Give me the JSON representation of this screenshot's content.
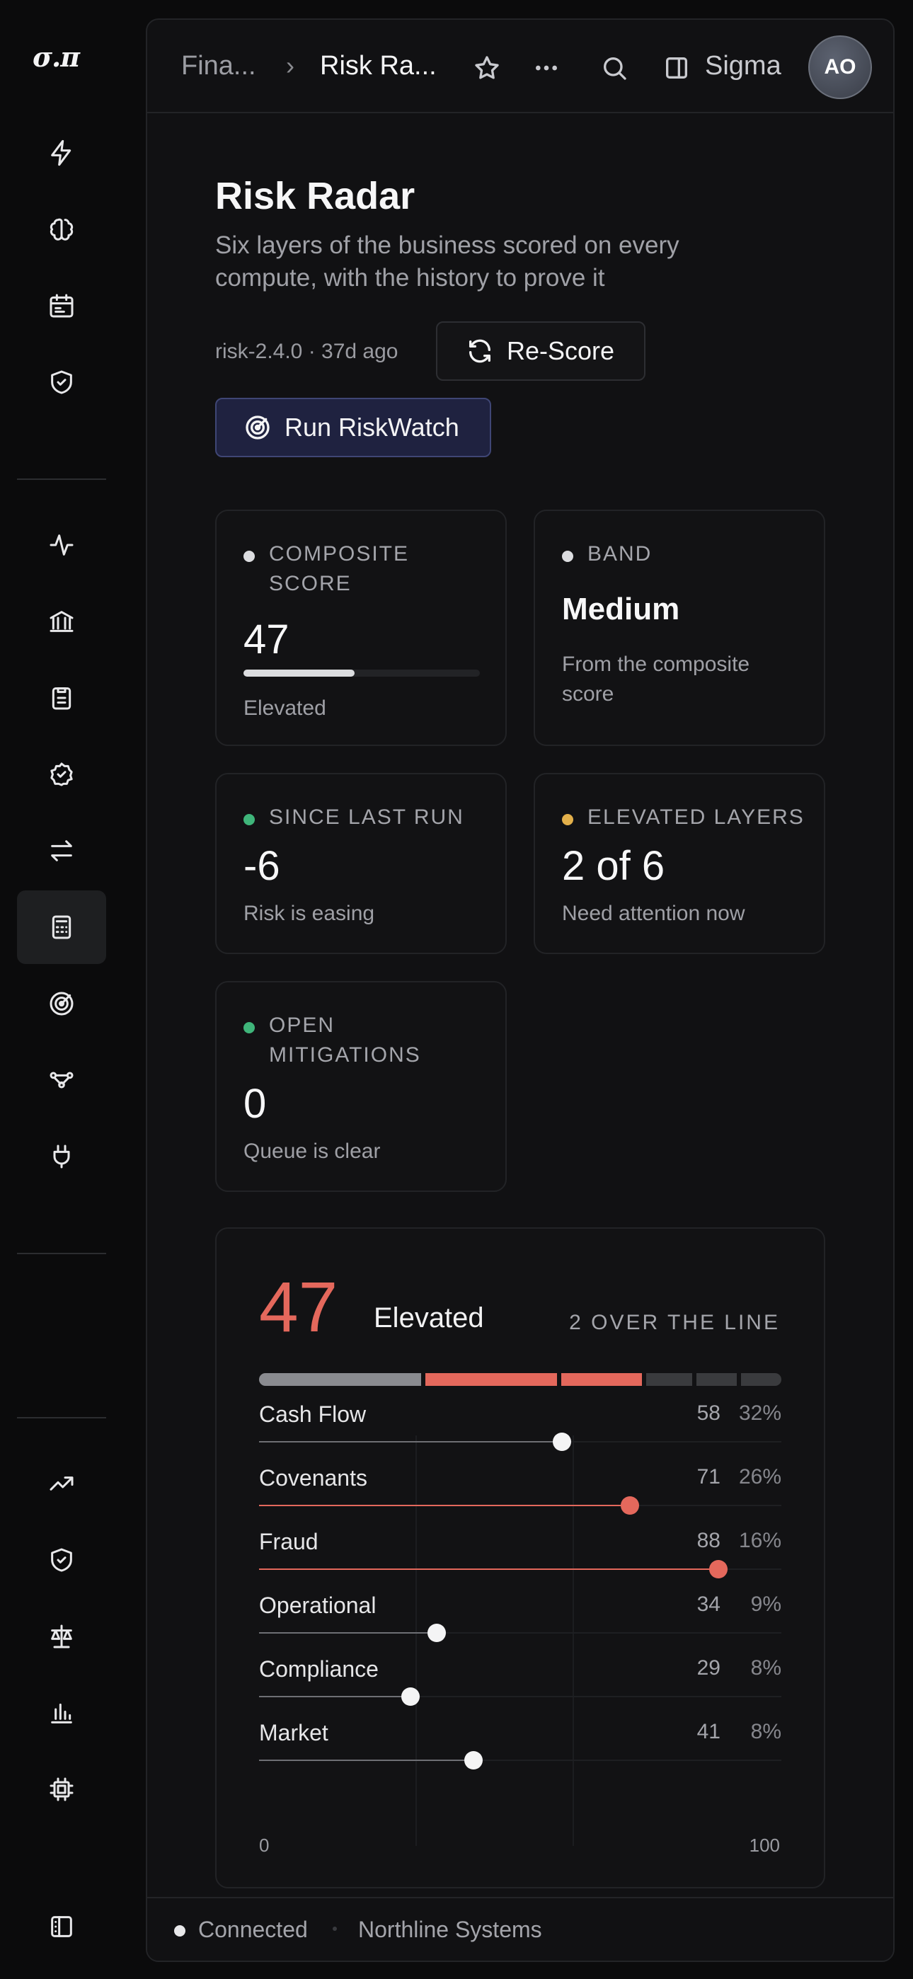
{
  "app": {
    "logo": "σ.π",
    "workspace": "Sigma",
    "avatar_initials": "AO"
  },
  "breadcrumb": {
    "parent": "Fina...",
    "current": "Risk Ra..."
  },
  "page": {
    "title": "Risk Radar",
    "subtitle": "Six layers of the business scored on every compute, with the history to prove it",
    "version": "risk-2.4.0 · 37d ago",
    "rescore_label": "Re-Score",
    "run_label": "Run RiskWatch"
  },
  "stats": {
    "composite": {
      "label": "Composite Score",
      "value": "47",
      "sub": "Elevated",
      "progress": 0.47,
      "dot_color": "#dcdde0"
    },
    "band": {
      "label": "Band",
      "value": "Medium",
      "sub": "From the composite score",
      "dot_color": "#dcdde0"
    },
    "since": {
      "label": "Since Last Run",
      "value": "-6",
      "sub": "Risk is easing",
      "dot_color": "#3fb57a"
    },
    "elevated": {
      "label": "Elevated Layers",
      "value": "2 of 6",
      "sub": "Need attention now",
      "dot_color": "#e3b04b"
    },
    "mitigations": {
      "label": "Open Mitigations",
      "value": "0",
      "sub": "Queue is clear",
      "dot_color": "#3fb57a"
    }
  },
  "radar": {
    "score": "47",
    "band": "Elevated",
    "over_line": "2 OVER THE LINE",
    "axis_min": "0",
    "axis_max": "100",
    "threshold": 60,
    "layers": [
      {
        "name": "Cash Flow",
        "score": 58,
        "weight": "32%",
        "weight_value": 32
      },
      {
        "name": "Covenants",
        "score": 71,
        "weight": "26%",
        "weight_value": 26
      },
      {
        "name": "Fraud",
        "score": 88,
        "weight": "16%",
        "weight_value": 16
      },
      {
        "name": "Operational",
        "score": 34,
        "weight": "9%",
        "weight_value": 9
      },
      {
        "name": "Compliance",
        "score": 29,
        "weight": "8%",
        "weight_value": 8
      },
      {
        "name": "Market",
        "score": 41,
        "weight": "8%",
        "weight_value": 8
      }
    ],
    "colors": {
      "over": "#e4685c",
      "normal": "#6e6f74",
      "muted": "#3a3b3e",
      "knob": "#f4f4f5"
    }
  },
  "footer": {
    "status": "Connected",
    "org": "Northline Systems"
  }
}
